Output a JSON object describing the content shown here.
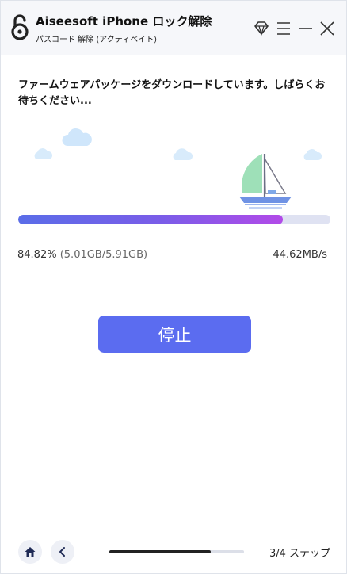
{
  "header": {
    "title": "Aiseesoft iPhone ロック解除",
    "subtitle": "パスコード 解除 (アクティベイト)",
    "icons": {
      "logo": "open-padlock-icon",
      "premium": "diamond-icon",
      "menu": "menu-icon",
      "minimize": "minimize-icon",
      "close": "close-icon"
    }
  },
  "status": {
    "message": "ファームウェアパッケージをダウンロードしています。しばらくお待ちください...",
    "progress_fraction": 0.8482,
    "percent_text": "84.82%",
    "size_text": "(5.01GB/5.91GB)",
    "speed_text": "44.62MB/s"
  },
  "actions": {
    "stop_label": "停止"
  },
  "footer": {
    "home_icon": "home-icon",
    "back_icon": "chevron-left-icon",
    "step_fraction": 0.75,
    "step_text": "3/4 ステップ"
  },
  "colors": {
    "accent": "#5b6cf0",
    "progress_start": "#5a6de8",
    "progress_end": "#b24ae8",
    "track": "#dfe2f2",
    "sail": "#9ee0b8",
    "cloud": "#cfe6fb"
  }
}
